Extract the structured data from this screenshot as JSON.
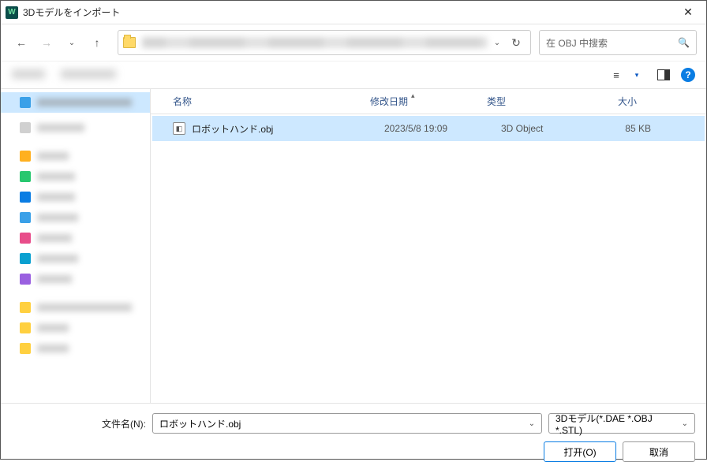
{
  "title": "3Dモデルをインポート",
  "search_placeholder": "在 OBJ 中搜索",
  "columns": {
    "name": "名称",
    "date": "修改日期",
    "type": "类型",
    "size": "大小"
  },
  "file": {
    "name": "ロボットハンド.obj",
    "date": "2023/5/8 19:09",
    "type": "3D Object",
    "size": "85 KB"
  },
  "labels": {
    "filename": "文件名(N):"
  },
  "filename_value": "ロボットハンド.obj",
  "filter": "3Dモデル(*.DAE *.OBJ *.STL)",
  "buttons": {
    "open": "打开(O)",
    "cancel": "取消"
  },
  "sidebar_colors": [
    "#3aa0e8",
    "#ffb020",
    "#28c76f",
    "#e04848",
    "#0a7de3",
    "#e84d8a",
    "#0aa0d0",
    "#f0b400",
    "#9a60e0",
    "#ffd040",
    "#ffb020",
    "#ffd040"
  ]
}
